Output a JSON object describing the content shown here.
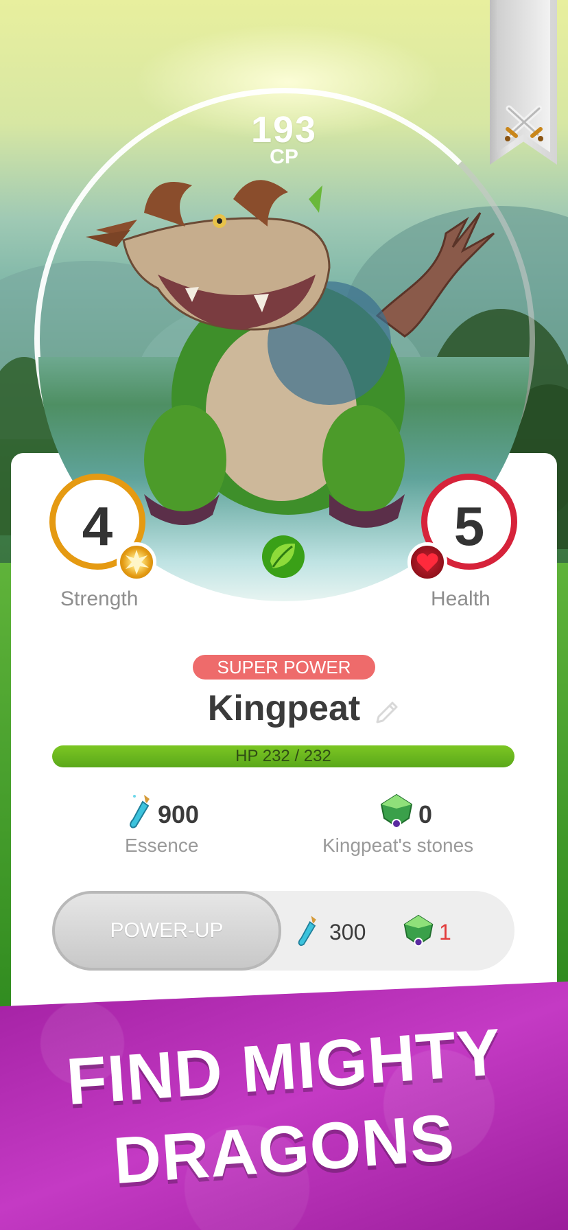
{
  "cp": {
    "value": "193",
    "label": "CP"
  },
  "stats": {
    "strength": {
      "value": "4",
      "label": "Strength"
    },
    "health": {
      "value": "5",
      "label": "Health"
    }
  },
  "dragon": {
    "tag": "SUPER POWER",
    "name": "Kingpeat",
    "hp_text": "HP 232 / 232",
    "hp_fraction": 1.0
  },
  "resources": {
    "essence": {
      "value": "900",
      "label": "Essence"
    },
    "stones": {
      "value": "0",
      "label": "Kingpeat's stones"
    }
  },
  "powerup": {
    "button_label": "POWER-UP",
    "essence_cost": "300",
    "stone_cost": "1"
  },
  "banner": {
    "line1": "FIND MIGHTY",
    "line2": "DRAGONS"
  },
  "colors": {
    "strength_ring": "#e59a12",
    "health_ring": "#d6233a",
    "hp_bar": "#6cbb1f",
    "super_power": "#ee6b6b",
    "banner": "#b62cb6"
  },
  "icons": [
    "crossed-swords-icon",
    "pencil-icon",
    "leaf-element-icon",
    "burst-icon",
    "heart-icon",
    "essence-potion-icon",
    "dragon-stone-icon"
  ]
}
